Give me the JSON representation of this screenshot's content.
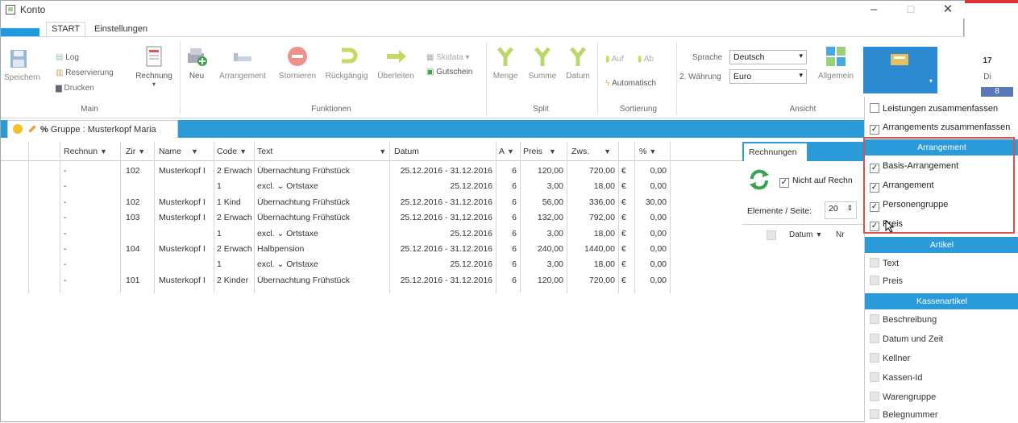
{
  "window": {
    "title": "Konto",
    "minimize": "–",
    "maximize": "☐",
    "close": "✕"
  },
  "tabs": [
    {
      "label": "START"
    },
    {
      "label": "Einstellungen"
    }
  ],
  "ribbon": {
    "main": {
      "save": "Speichern",
      "log": "Log",
      "reservation": "Reservierung",
      "print": "Drucken",
      "invoice": "Rechnung",
      "group_label": "Main"
    },
    "functions": {
      "new": "Neu",
      "arrangement": "Arrangement",
      "cancel": "Stornieren",
      "undo": "Rückgängig",
      "forward": "Überleiten",
      "skidata": "Skidata",
      "voucher": "Gutschein",
      "group_label": "Funktionen"
    },
    "split": {
      "quantity": "Menge",
      "sum": "Summe",
      "date": "Datum",
      "group_label": "Split"
    },
    "sort": {
      "up": "Auf",
      "down": "Ab",
      "auto": "Automatisch",
      "group_label": "Sortierung"
    },
    "view": {
      "language_label": "Sprache",
      "language_value": "Deutsch",
      "currency2_label": "2. Währung",
      "currency2_value": "Euro",
      "general": "Allgemein",
      "group_label": "Ansicht"
    }
  },
  "group_tab": {
    "label": "Gruppe : Musterkopf Maria",
    "percent": "%"
  },
  "table": {
    "headers": [
      "Rechnun",
      "Zir",
      "Name",
      "Code",
      "Text",
      "Datum",
      "A",
      "Preis",
      "Zws.",
      "",
      "%"
    ],
    "rows": [
      [
        "-",
        "102",
        "Musterkopf I",
        "2 Erwach",
        "Übernachtung Frühstück",
        "25.12.2016 - 31.12.2016",
        "6",
        "120,00",
        "720,00",
        "€",
        "0,00"
      ],
      [
        "-",
        "",
        "",
        "1",
        "excl.  ⌄  Ortstaxe",
        "25.12.2016",
        "6",
        "3,00",
        "18,00",
        "€",
        "0,00"
      ],
      [
        "-",
        "102",
        "Musterkopf I",
        "1 Kind",
        "Übernachtung Frühstück",
        "25.12.2016 - 31.12.2016",
        "6",
        "56,00",
        "336,00",
        "€",
        "30,00"
      ],
      [
        "-",
        "103",
        "Musterkopf I",
        "2 Erwach",
        "Übernachtung Frühstück",
        "25.12.2016 - 31.12.2016",
        "6",
        "132,00",
        "792,00",
        "€",
        "0,00"
      ],
      [
        "-",
        "",
        "",
        "1",
        "excl.  ⌄  Ortstaxe",
        "25.12.2016",
        "6",
        "3,00",
        "18,00",
        "€",
        "0,00"
      ],
      [
        "-",
        "104",
        "Musterkopf I",
        "2 Erwach",
        "Halbpension",
        "25.12.2016 - 31.12.2016",
        "6",
        "240,00",
        "1440,00",
        "€",
        "0,00"
      ],
      [
        "-",
        "",
        "",
        "1",
        "excl.  ⌄  Ortstaxe",
        "25.12.2016",
        "6",
        "3,00",
        "18,00",
        "€",
        "0,00"
      ],
      [
        "-",
        "101",
        "Musterkopf I",
        "2 Kinder",
        "Übernachtung Frühstück",
        "25.12.2016 - 31.12.2016",
        "6",
        "120,00",
        "720,00",
        "€",
        "0,00"
      ]
    ]
  },
  "invoices_panel": {
    "tab": "Rechnungen",
    "not_on_invoice": "Nicht auf Rechn",
    "per_page_label": "Elemente / Seite:",
    "per_page_value": "20",
    "col_date": "Datum",
    "col_nr": "Nr"
  },
  "dropdown": {
    "top_items": [
      {
        "label": "Leistungen zusammenfassen",
        "checked": false
      },
      {
        "label": "Arrangements zusammenfassen",
        "checked": true
      }
    ],
    "sections": [
      {
        "title": "Arrangement",
        "items": [
          {
            "label": "Basis-Arrangement",
            "checked": true
          },
          {
            "label": "Arrangement",
            "checked": true
          },
          {
            "label": "Personengruppe",
            "checked": true
          },
          {
            "label": "Preis",
            "checked": true
          }
        ]
      },
      {
        "title": "Artikel",
        "items": [
          {
            "label": "Text"
          },
          {
            "label": "Preis"
          }
        ]
      },
      {
        "title": "Kassenartikel",
        "items": [
          {
            "label": "Beschreibung"
          },
          {
            "label": "Datum und Zeit"
          },
          {
            "label": "Kellner"
          },
          {
            "label": "Kassen-Id"
          },
          {
            "label": "Warengruppe"
          },
          {
            "label": "Belegnummer"
          }
        ]
      }
    ]
  },
  "calendar_strip": {
    "day_num": "17",
    "day_name": "Di",
    "extra": "8"
  }
}
